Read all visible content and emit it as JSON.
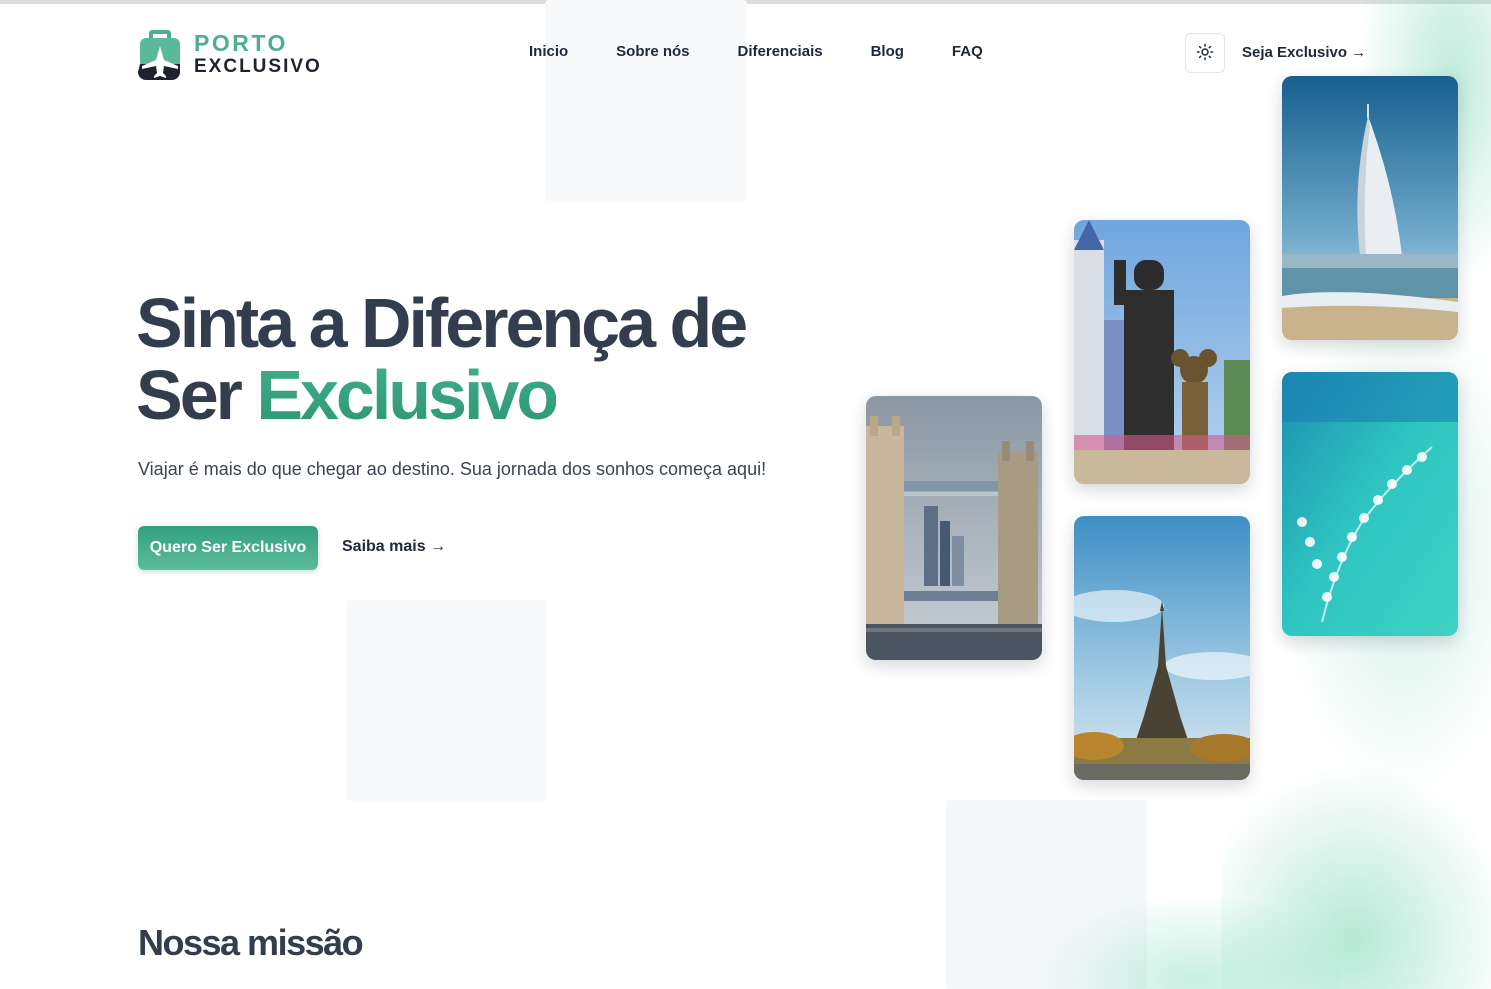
{
  "brand": {
    "line1": "PORTO",
    "line2": "EXCLUSIVO"
  },
  "nav": {
    "items": [
      "Inicio",
      "Sobre nós",
      "Diferenciais",
      "Blog",
      "FAQ"
    ]
  },
  "header": {
    "theme_icon": "sun-icon",
    "cta_label": "Seja Exclusivo →"
  },
  "hero": {
    "title_line1": "Sinta a Diferença de",
    "title_line2_plain": "Ser ",
    "title_line2_accent": "Exclusivo",
    "subtitle": "Viajar é mais do que chegar ao destino. Sua jornada dos sonhos começa aqui!",
    "primary_button": "Quero Ser Exclusivo",
    "secondary_link": "Saiba mais →"
  },
  "gallery": [
    "london-tower-bridge-photo",
    "disney-statue-photo",
    "paris-eiffel-tower-photo",
    "dubai-burj-al-arab-photo",
    "maldives-villas-photo"
  ],
  "mission": {
    "heading": "Nossa missão"
  },
  "colors": {
    "accent": "#3fa587",
    "text": "#333d4d",
    "brand_dark": "#1f2230"
  }
}
